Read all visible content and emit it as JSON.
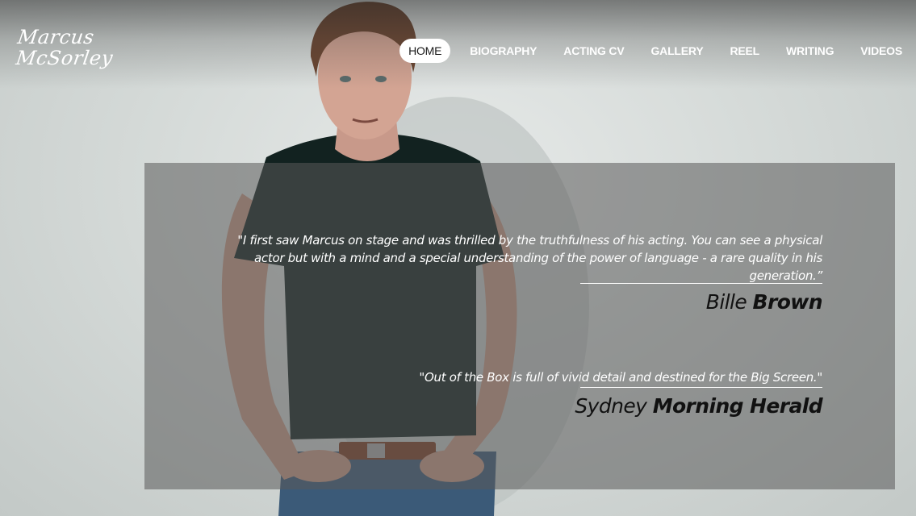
{
  "logo": {
    "line1": "Marcus",
    "line2": "McSorley"
  },
  "nav": {
    "items": [
      {
        "label": "HOME",
        "active": true
      },
      {
        "label": "BIOGRAPHY"
      },
      {
        "label": "ACTING CV"
      },
      {
        "label": "GALLERY"
      },
      {
        "label": "REEL"
      },
      {
        "label": "WRITING"
      },
      {
        "label": "VIDEOS"
      }
    ]
  },
  "quotes": [
    {
      "text": "\"I first saw Marcus on stage and was thrilled by the truthfulness of his acting. You can see a physical actor but with a mind and a special understanding of the power of language - a rare quality in his generation.”",
      "author_first": "Bille",
      "author_last": "Brown"
    },
    {
      "text": "\"Out of the Box is full of vivid detail and destined for the Big Screen.\"",
      "author_first": "Sydney",
      "author_last": "Morning Herald"
    }
  ],
  "colors": {
    "nav_text": "#ffffff",
    "nav_active_bg": "#ffffff",
    "panel_bg": "rgba(90,90,90,0.55)",
    "author_text": "#111111"
  }
}
